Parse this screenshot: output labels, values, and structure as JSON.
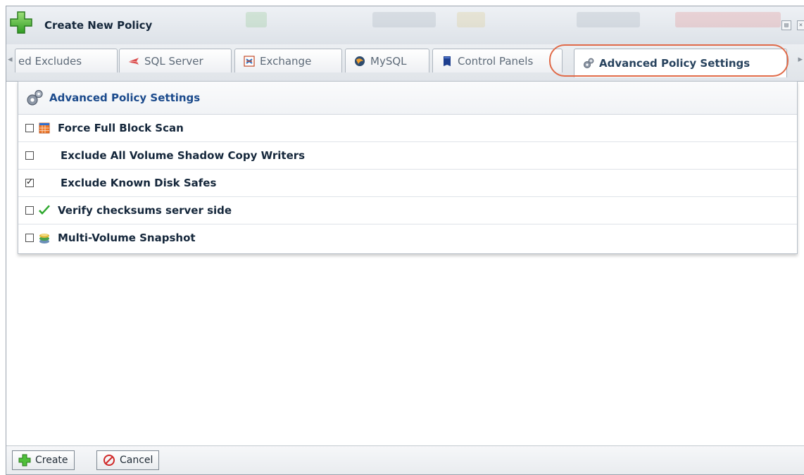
{
  "window": {
    "title": "Create New Policy"
  },
  "tabs": [
    {
      "label": "ed Excludes",
      "icon": "partial-tab-icon"
    },
    {
      "label": "SQL Server",
      "icon": "sql-server-icon"
    },
    {
      "label": "Exchange",
      "icon": "exchange-icon"
    },
    {
      "label": "MySQL",
      "icon": "mysql-icon"
    },
    {
      "label": "Control Panels",
      "icon": "control-panels-icon"
    },
    {
      "label": "Advanced Policy Settings",
      "icon": "gears-icon",
      "active": true
    }
  ],
  "panel": {
    "title": "Advanced Policy Settings",
    "options": [
      {
        "label": "Force Full Block Scan",
        "checked": false,
        "icon": "calendar-icon"
      },
      {
        "label": "Exclude All Volume Shadow Copy Writers",
        "checked": false,
        "icon": ""
      },
      {
        "label": "Exclude Known Disk Safes",
        "checked": true,
        "icon": ""
      },
      {
        "label": "Verify checksums server side",
        "checked": false,
        "icon": "checkmark-icon"
      },
      {
        "label": "Multi-Volume Snapshot",
        "checked": false,
        "icon": "volume-stack-icon"
      }
    ]
  },
  "footer": {
    "create_label": "Create",
    "cancel_label": "Cancel"
  },
  "colors": {
    "accent": "#1b4a8c",
    "highlight": "#e06a48",
    "success": "#2ea82e"
  }
}
